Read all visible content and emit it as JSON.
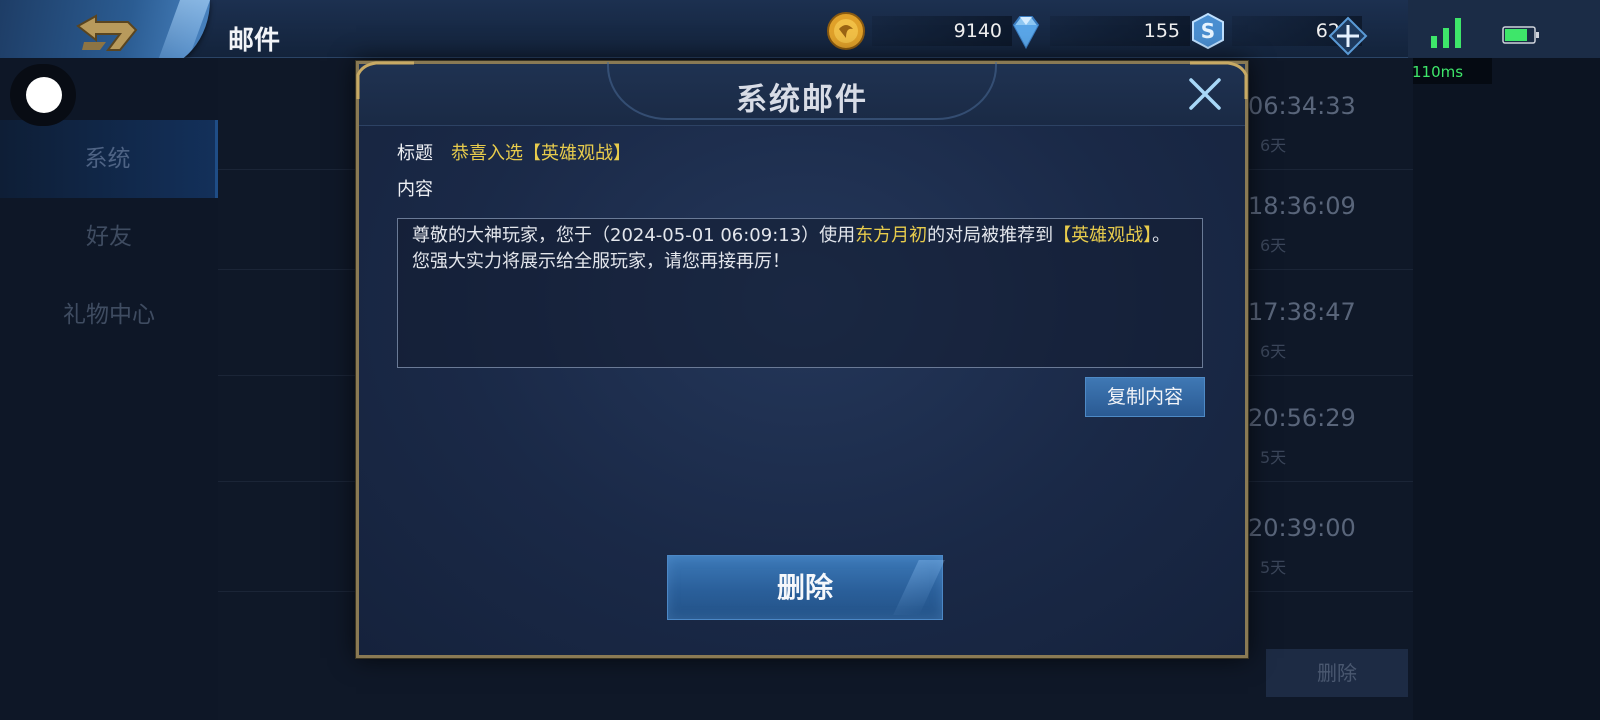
{
  "topbar": {
    "title": "邮件",
    "gold": "9140",
    "diamond": "155",
    "ticket": "629",
    "ping": "110ms"
  },
  "sidebar": {
    "items": [
      {
        "label": "系统",
        "active": true
      },
      {
        "label": "好友",
        "active": false
      },
      {
        "label": "礼物中心",
        "active": false
      }
    ]
  },
  "mail_list": {
    "rows": [
      {
        "time": "06:34:33",
        "days": "6天"
      },
      {
        "time": "18:36:09",
        "days": "6天"
      },
      {
        "time": "17:38:47",
        "days": "6天"
      },
      {
        "time": "20:56:29",
        "days": "5天"
      },
      {
        "time": "20:39:00",
        "days": "5天"
      }
    ],
    "delete_label": "删除"
  },
  "dialog": {
    "title": "系统邮件",
    "subject_label": "标题",
    "subject_value": "恭喜入选【英雄观战】",
    "content_label": "内容",
    "body": {
      "p1": "尊敬的大神玩家，您于（2024-05-01 06:09:13）使用",
      "hero": "东方月初",
      "p2": "的对局被推荐到",
      "tag": "【英雄观战】",
      "p3": "。",
      "line2": "您强大实力将展示给全服玩家，请您再接再厉！"
    },
    "copy_label": "复制内容",
    "delete_label": "删除"
  },
  "colors": {
    "accent_gold": "#e8cc4c",
    "button_blue": "#2a5f9a",
    "ping_green": "#3ee66a",
    "dialog_border": "#8a7a54"
  }
}
